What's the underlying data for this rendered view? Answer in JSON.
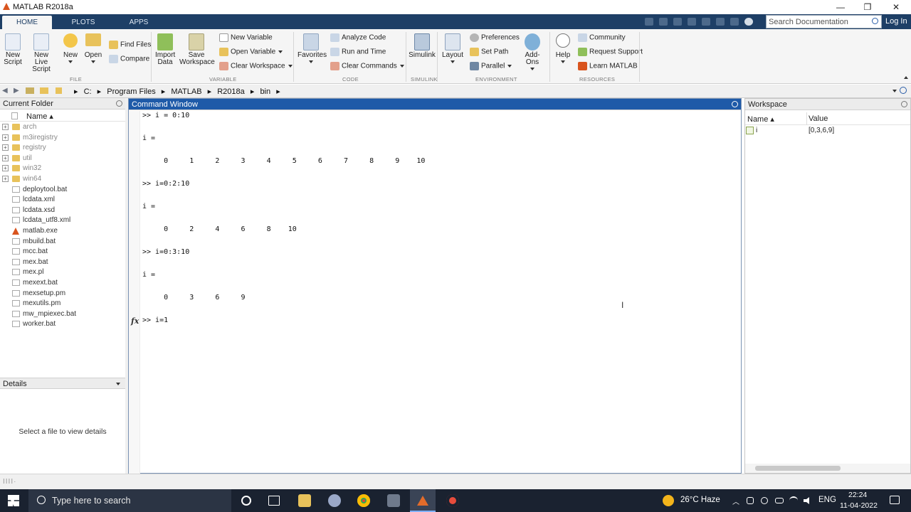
{
  "window": {
    "title": "MATLAB R2018a",
    "minimize": "—",
    "restore": "❐",
    "close": "✕"
  },
  "tabs": [
    {
      "label": "HOME",
      "active": true
    },
    {
      "label": "PLOTS",
      "active": false
    },
    {
      "label": "APPS",
      "active": false
    }
  ],
  "search": {
    "placeholder": "Search Documentation"
  },
  "login": "Log In",
  "ribbon": {
    "file": {
      "new_script": [
        "New",
        "Script"
      ],
      "new_live_script": [
        "New",
        "Live Script"
      ],
      "new": "New",
      "open": "Open",
      "find_files": "Find Files",
      "compare": "Compare",
      "section": "FILE"
    },
    "variable": {
      "import_data": [
        "Import",
        "Data"
      ],
      "save_workspace": [
        "Save",
        "Workspace"
      ],
      "new_variable": "New Variable",
      "open_variable": "Open Variable",
      "clear_workspace": "Clear Workspace",
      "section": "VARIABLE"
    },
    "code": {
      "favorites": "Favorites",
      "analyze_code": "Analyze Code",
      "run_and_time": "Run and Time",
      "clear_commands": "Clear Commands",
      "section": "CODE"
    },
    "simulink": {
      "simulink": "Simulink",
      "section": "SIMULINK"
    },
    "environment": {
      "layout": "Layout",
      "preferences": "Preferences",
      "set_path": "Set Path",
      "parallel": "Parallel",
      "addons": "Add-Ons",
      "section": "ENVIRONMENT"
    },
    "resources": {
      "help": "Help",
      "community": "Community",
      "request_support": "Request Support",
      "learn_matlab": "Learn MATLAB",
      "section": "RESOURCES"
    }
  },
  "address": {
    "crumbs": [
      "C:",
      "Program Files",
      "MATLAB",
      "R2018a",
      "bin"
    ],
    "sep": "▸"
  },
  "current_folder": {
    "title": "Current Folder",
    "column": "Name ▴",
    "items": [
      {
        "name": "arch",
        "type": "folder"
      },
      {
        "name": "m3iregistry",
        "type": "folder"
      },
      {
        "name": "registry",
        "type": "folder"
      },
      {
        "name": "util",
        "type": "folder"
      },
      {
        "name": "win32",
        "type": "folder"
      },
      {
        "name": "win64",
        "type": "folder"
      },
      {
        "name": "deploytool.bat",
        "type": "file"
      },
      {
        "name": "lcdata.xml",
        "type": "file"
      },
      {
        "name": "lcdata.xsd",
        "type": "file"
      },
      {
        "name": "lcdata_utf8.xml",
        "type": "file"
      },
      {
        "name": "matlab.exe",
        "type": "exe"
      },
      {
        "name": "mbuild.bat",
        "type": "file"
      },
      {
        "name": "mcc.bat",
        "type": "file"
      },
      {
        "name": "mex.bat",
        "type": "file"
      },
      {
        "name": "mex.pl",
        "type": "file"
      },
      {
        "name": "mexext.bat",
        "type": "file"
      },
      {
        "name": "mexsetup.pm",
        "type": "file"
      },
      {
        "name": "mexutils.pm",
        "type": "file"
      },
      {
        "name": "mw_mpiexec.bat",
        "type": "file"
      },
      {
        "name": "worker.bat",
        "type": "file"
      }
    ]
  },
  "details": {
    "title": "Details",
    "message": "Select a file to view details"
  },
  "command_window": {
    "title": "Command Window",
    "fx": "fx",
    "lines": [
      ">> i = 0:10",
      "",
      "i =",
      "",
      "     0     1     2     3     4     5     6     7     8     9    10",
      "",
      ">> i=0:2:10",
      "",
      "i =",
      "",
      "     0     2     4     6     8    10",
      "",
      ">> i=0:3:10",
      "",
      "i =",
      "",
      "     0     3     6     9",
      "",
      ">> i=1"
    ]
  },
  "workspace": {
    "title": "Workspace",
    "columns": [
      "Name ▴",
      "Value"
    ],
    "rows": [
      {
        "name": "i",
        "value": "[0,3,6,9]"
      }
    ]
  },
  "status": {
    "text": "IIII·"
  },
  "taskbar": {
    "search_placeholder": "Type here to search",
    "weather": "26°C  Haze",
    "language": "ENG",
    "time": "22:24",
    "date": "11-04-2022"
  },
  "colors": {
    "tabstrip": "#1e3f66",
    "command_header": "#1e5aa8",
    "matlab_logo": "#d9541e"
  }
}
